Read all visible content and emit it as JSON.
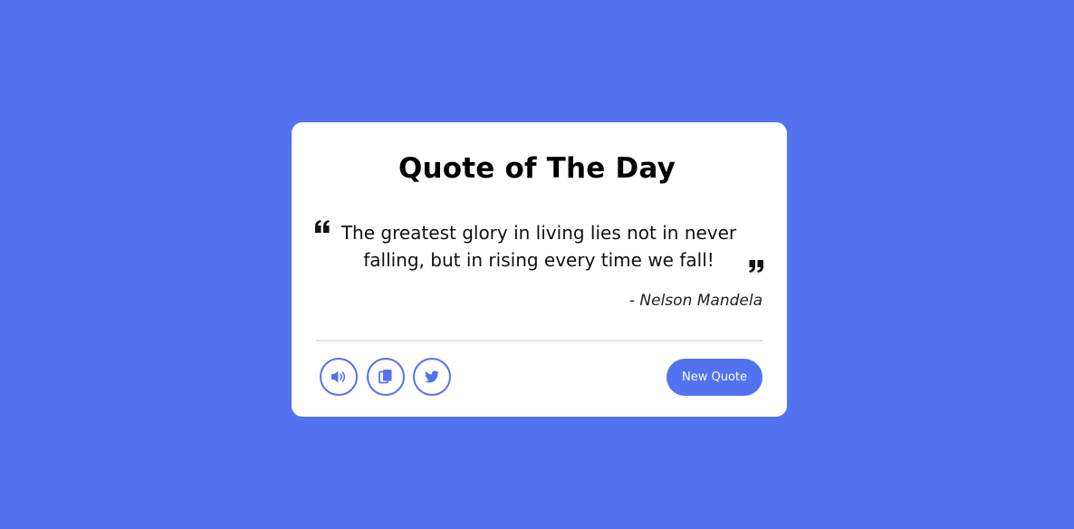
{
  "card": {
    "title": "Quote of The Day",
    "quote": "The greatest glory in living lies not in never falling, but in rising every time we fall!",
    "author": "- Nelson Mandela"
  },
  "actions": {
    "sound_icon": "volume-icon",
    "copy_icon": "copy-icon",
    "twitter_icon": "twitter-icon",
    "new_quote_label": "New Quote"
  },
  "colors": {
    "background": "#5372f0",
    "accent": "#5372f0",
    "card": "#ffffff"
  }
}
